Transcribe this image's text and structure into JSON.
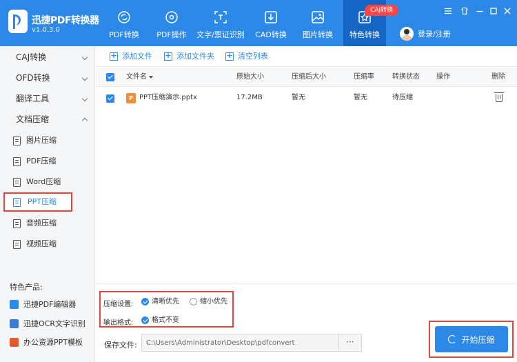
{
  "app": {
    "name": "迅捷PDF转换器",
    "version": "v1.0.3.0"
  },
  "colors": {
    "primary": "#2c89e8",
    "active_tab": "#1566c4",
    "highlight": "#e8433d",
    "badge": "#ff4545",
    "file_icon": "#f08d3a"
  },
  "nav": {
    "tabs": [
      {
        "label": "PDF转换",
        "icon": "refresh-doc-icon"
      },
      {
        "label": "PDF操作",
        "icon": "disc-icon"
      },
      {
        "label": "文字/票证识别",
        "icon": "scan-text-icon"
      },
      {
        "label": "CAD转换",
        "icon": "download-box-icon"
      },
      {
        "label": "图片转换",
        "icon": "image-icon"
      },
      {
        "label": "特色转换",
        "icon": "star-box-icon"
      }
    ],
    "active_index": 5,
    "badge": "CAJ转换",
    "login": "登录/注册"
  },
  "sidebar": {
    "categories": [
      {
        "label": "CAJ转换",
        "expanded": false
      },
      {
        "label": "OFD转换",
        "expanded": false
      },
      {
        "label": "翻译工具",
        "expanded": false
      },
      {
        "label": "文档压缩",
        "expanded": true
      }
    ],
    "items": [
      {
        "label": "图片压缩"
      },
      {
        "label": "PDF压缩"
      },
      {
        "label": "Word压缩"
      },
      {
        "label": "PPT压缩"
      },
      {
        "label": "音频压缩"
      },
      {
        "label": "视频压缩"
      }
    ],
    "active_item": "PPT压缩",
    "featured_title": "特色产品:",
    "featured": [
      {
        "label": "迅捷PDF编辑器",
        "icon": "pdf-editor-icon"
      },
      {
        "label": "迅捷OCR文字识别",
        "icon": "ocr-icon"
      },
      {
        "label": "办公资源PPT模板",
        "icon": "ppt-template-icon"
      }
    ]
  },
  "toolbar": {
    "add_file": "添加文件",
    "add_folder": "添加文件夹",
    "clear_list": "清空列表"
  },
  "table": {
    "headers": {
      "name": "文件名",
      "orig_size": "原始大小",
      "comp_size": "压缩后大小",
      "ratio": "压缩率",
      "status": "转换状态",
      "action": "操作",
      "delete": "删除"
    },
    "rows": [
      {
        "name": "PPT压缩演示.pptx",
        "orig_size": "17.2MB",
        "comp_size": "暂无",
        "ratio": "暂无",
        "status": "待压缩",
        "checked": true
      }
    ]
  },
  "settings": {
    "compress_label": "压缩设置:",
    "opt_clear": "清晰优先",
    "opt_small": "缩小优先",
    "selected": "清晰优先",
    "output_label": "输出格式:",
    "output_keep": "格式不变"
  },
  "save": {
    "label": "保存文件:",
    "path": "C:\\Users\\Administrator\\Desktop\\pdfconvert",
    "browse": "···"
  },
  "start_button": "开始压缩"
}
